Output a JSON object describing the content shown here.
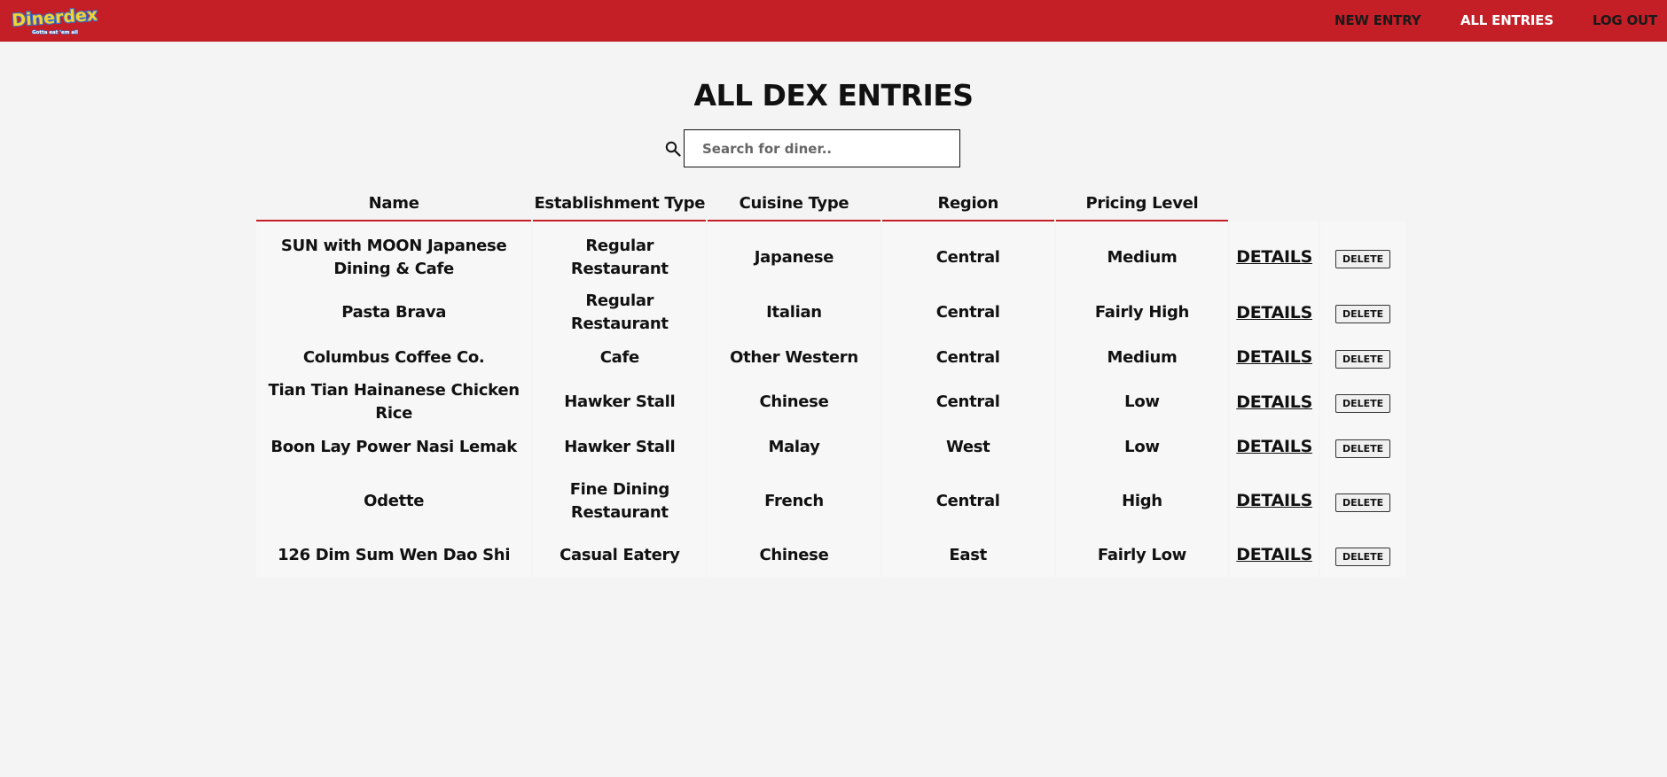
{
  "app": {
    "logo_text": "Dinerdex",
    "logo_tagline": "Gotta eat 'em all"
  },
  "nav": {
    "new_entry": "NEW ENTRY",
    "all_entries": "ALL ENTRIES",
    "log_out": "LOG OUT"
  },
  "page": {
    "title": "ALL DEX ENTRIES"
  },
  "search": {
    "placeholder": "Search for diner..",
    "value": ""
  },
  "colors": {
    "brand_red": "#c41e26",
    "logo_yellow": "#f4d230",
    "logo_blue": "#3b6fc9",
    "background": "#f4f4f4"
  },
  "table": {
    "headers": [
      "Name",
      "Establishment Type",
      "Cuisine Type",
      "Region",
      "Pricing Level"
    ],
    "details_label": "DETAILS",
    "delete_label": "DELETE",
    "rows": [
      {
        "name": "SUN with MOON Japanese Dining & Cafe",
        "establishment": "Regular Restaurant",
        "cuisine": "Japanese",
        "region": "Central",
        "pricing": "Medium"
      },
      {
        "name": "Pasta Brava",
        "establishment": "Regular Restaurant",
        "cuisine": "Italian",
        "region": "Central",
        "pricing": "Fairly High"
      },
      {
        "name": "Columbus Coffee Co.",
        "establishment": "Cafe",
        "cuisine": "Other Western",
        "region": "Central",
        "pricing": "Medium"
      },
      {
        "name": "Tian Tian Hainanese Chicken Rice",
        "establishment": "Hawker Stall",
        "cuisine": "Chinese",
        "region": "Central",
        "pricing": "Low"
      },
      {
        "name": "Boon Lay Power Nasi Lemak",
        "establishment": "Hawker Stall",
        "cuisine": "Malay",
        "region": "West",
        "pricing": "Low"
      },
      {
        "name": "Odette",
        "establishment": "Fine Dining Restaurant",
        "cuisine": "French",
        "region": "Central",
        "pricing": "High"
      },
      {
        "name": "126 Dim Sum Wen Dao Shi",
        "establishment": "Casual Eatery",
        "cuisine": "Chinese",
        "region": "East",
        "pricing": "Fairly Low"
      }
    ]
  }
}
